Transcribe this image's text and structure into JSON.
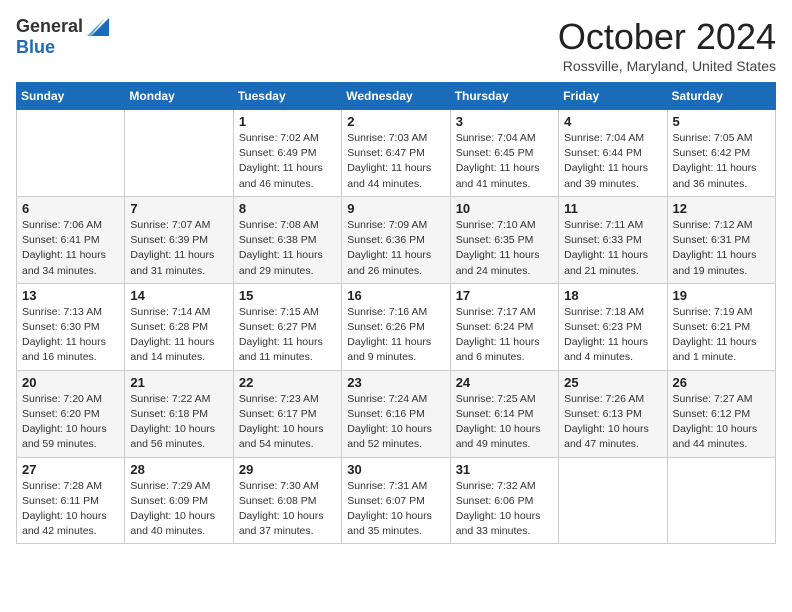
{
  "header": {
    "logo_general": "General",
    "logo_blue": "Blue",
    "month": "October 2024",
    "location": "Rossville, Maryland, United States"
  },
  "days_of_week": [
    "Sunday",
    "Monday",
    "Tuesday",
    "Wednesday",
    "Thursday",
    "Friday",
    "Saturday"
  ],
  "weeks": [
    [
      {
        "day": "",
        "info": ""
      },
      {
        "day": "",
        "info": ""
      },
      {
        "day": "1",
        "info": "Sunrise: 7:02 AM\nSunset: 6:49 PM\nDaylight: 11 hours and 46 minutes."
      },
      {
        "day": "2",
        "info": "Sunrise: 7:03 AM\nSunset: 6:47 PM\nDaylight: 11 hours and 44 minutes."
      },
      {
        "day": "3",
        "info": "Sunrise: 7:04 AM\nSunset: 6:45 PM\nDaylight: 11 hours and 41 minutes."
      },
      {
        "day": "4",
        "info": "Sunrise: 7:04 AM\nSunset: 6:44 PM\nDaylight: 11 hours and 39 minutes."
      },
      {
        "day": "5",
        "info": "Sunrise: 7:05 AM\nSunset: 6:42 PM\nDaylight: 11 hours and 36 minutes."
      }
    ],
    [
      {
        "day": "6",
        "info": "Sunrise: 7:06 AM\nSunset: 6:41 PM\nDaylight: 11 hours and 34 minutes."
      },
      {
        "day": "7",
        "info": "Sunrise: 7:07 AM\nSunset: 6:39 PM\nDaylight: 11 hours and 31 minutes."
      },
      {
        "day": "8",
        "info": "Sunrise: 7:08 AM\nSunset: 6:38 PM\nDaylight: 11 hours and 29 minutes."
      },
      {
        "day": "9",
        "info": "Sunrise: 7:09 AM\nSunset: 6:36 PM\nDaylight: 11 hours and 26 minutes."
      },
      {
        "day": "10",
        "info": "Sunrise: 7:10 AM\nSunset: 6:35 PM\nDaylight: 11 hours and 24 minutes."
      },
      {
        "day": "11",
        "info": "Sunrise: 7:11 AM\nSunset: 6:33 PM\nDaylight: 11 hours and 21 minutes."
      },
      {
        "day": "12",
        "info": "Sunrise: 7:12 AM\nSunset: 6:31 PM\nDaylight: 11 hours and 19 minutes."
      }
    ],
    [
      {
        "day": "13",
        "info": "Sunrise: 7:13 AM\nSunset: 6:30 PM\nDaylight: 11 hours and 16 minutes."
      },
      {
        "day": "14",
        "info": "Sunrise: 7:14 AM\nSunset: 6:28 PM\nDaylight: 11 hours and 14 minutes."
      },
      {
        "day": "15",
        "info": "Sunrise: 7:15 AM\nSunset: 6:27 PM\nDaylight: 11 hours and 11 minutes."
      },
      {
        "day": "16",
        "info": "Sunrise: 7:16 AM\nSunset: 6:26 PM\nDaylight: 11 hours and 9 minutes."
      },
      {
        "day": "17",
        "info": "Sunrise: 7:17 AM\nSunset: 6:24 PM\nDaylight: 11 hours and 6 minutes."
      },
      {
        "day": "18",
        "info": "Sunrise: 7:18 AM\nSunset: 6:23 PM\nDaylight: 11 hours and 4 minutes."
      },
      {
        "day": "19",
        "info": "Sunrise: 7:19 AM\nSunset: 6:21 PM\nDaylight: 11 hours and 1 minute."
      }
    ],
    [
      {
        "day": "20",
        "info": "Sunrise: 7:20 AM\nSunset: 6:20 PM\nDaylight: 10 hours and 59 minutes."
      },
      {
        "day": "21",
        "info": "Sunrise: 7:22 AM\nSunset: 6:18 PM\nDaylight: 10 hours and 56 minutes."
      },
      {
        "day": "22",
        "info": "Sunrise: 7:23 AM\nSunset: 6:17 PM\nDaylight: 10 hours and 54 minutes."
      },
      {
        "day": "23",
        "info": "Sunrise: 7:24 AM\nSunset: 6:16 PM\nDaylight: 10 hours and 52 minutes."
      },
      {
        "day": "24",
        "info": "Sunrise: 7:25 AM\nSunset: 6:14 PM\nDaylight: 10 hours and 49 minutes."
      },
      {
        "day": "25",
        "info": "Sunrise: 7:26 AM\nSunset: 6:13 PM\nDaylight: 10 hours and 47 minutes."
      },
      {
        "day": "26",
        "info": "Sunrise: 7:27 AM\nSunset: 6:12 PM\nDaylight: 10 hours and 44 minutes."
      }
    ],
    [
      {
        "day": "27",
        "info": "Sunrise: 7:28 AM\nSunset: 6:11 PM\nDaylight: 10 hours and 42 minutes."
      },
      {
        "day": "28",
        "info": "Sunrise: 7:29 AM\nSunset: 6:09 PM\nDaylight: 10 hours and 40 minutes."
      },
      {
        "day": "29",
        "info": "Sunrise: 7:30 AM\nSunset: 6:08 PM\nDaylight: 10 hours and 37 minutes."
      },
      {
        "day": "30",
        "info": "Sunrise: 7:31 AM\nSunset: 6:07 PM\nDaylight: 10 hours and 35 minutes."
      },
      {
        "day": "31",
        "info": "Sunrise: 7:32 AM\nSunset: 6:06 PM\nDaylight: 10 hours and 33 minutes."
      },
      {
        "day": "",
        "info": ""
      },
      {
        "day": "",
        "info": ""
      }
    ]
  ]
}
